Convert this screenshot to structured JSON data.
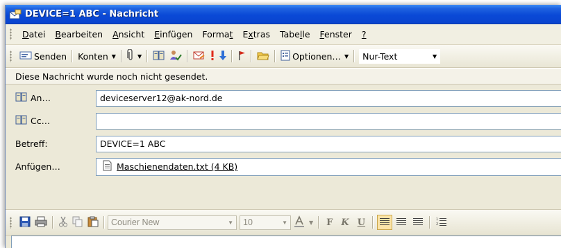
{
  "window": {
    "title": "DEVICE=1 ABC - Nachricht"
  },
  "menu": {
    "items": [
      {
        "label": "Datei",
        "key": "D",
        "rest": "atei"
      },
      {
        "label": "Bearbeiten",
        "key": "B",
        "rest": "earbeiten"
      },
      {
        "label": "Ansicht",
        "key": "A",
        "rest": "nsicht"
      },
      {
        "label": "Einfügen",
        "key": "E",
        "rest": "infügen"
      },
      {
        "label": "Format",
        "pre": "Forma",
        "key": "t",
        "rest": ""
      },
      {
        "label": "Extras",
        "pre": "E",
        "key": "x",
        "rest": "tras"
      },
      {
        "label": "Tabelle",
        "pre": "Tabe",
        "key": "l",
        "rest": "le"
      },
      {
        "label": "Fenster",
        "key": "F",
        "rest": "enster"
      },
      {
        "label": "?",
        "key": "?",
        "rest": ""
      }
    ]
  },
  "toolbar": {
    "send_label": "Senden",
    "accounts_label": "Konten",
    "options_label": "Optionen…",
    "format_value": "Nur-Text"
  },
  "infobar": {
    "text": "Diese Nachricht wurde noch nicht gesendet."
  },
  "headers": {
    "to_label": "An…",
    "to_value": "deviceserver12@ak-nord.de",
    "cc_label": "Cc…",
    "cc_value": "",
    "subject_label": "Betreff:",
    "subject_value": "DEVICE=1 ABC",
    "attach_label": "Anfügen…",
    "attachment": "Maschienendaten.txt (4 KB)"
  },
  "format_toolbar": {
    "font": "Courier New",
    "size": "10",
    "bold": "F",
    "italic": "K",
    "underline": "U"
  },
  "colors": {
    "title_bar": "#0a49d6",
    "chrome": "#ece9d8",
    "field_border": "#7f9db9"
  }
}
